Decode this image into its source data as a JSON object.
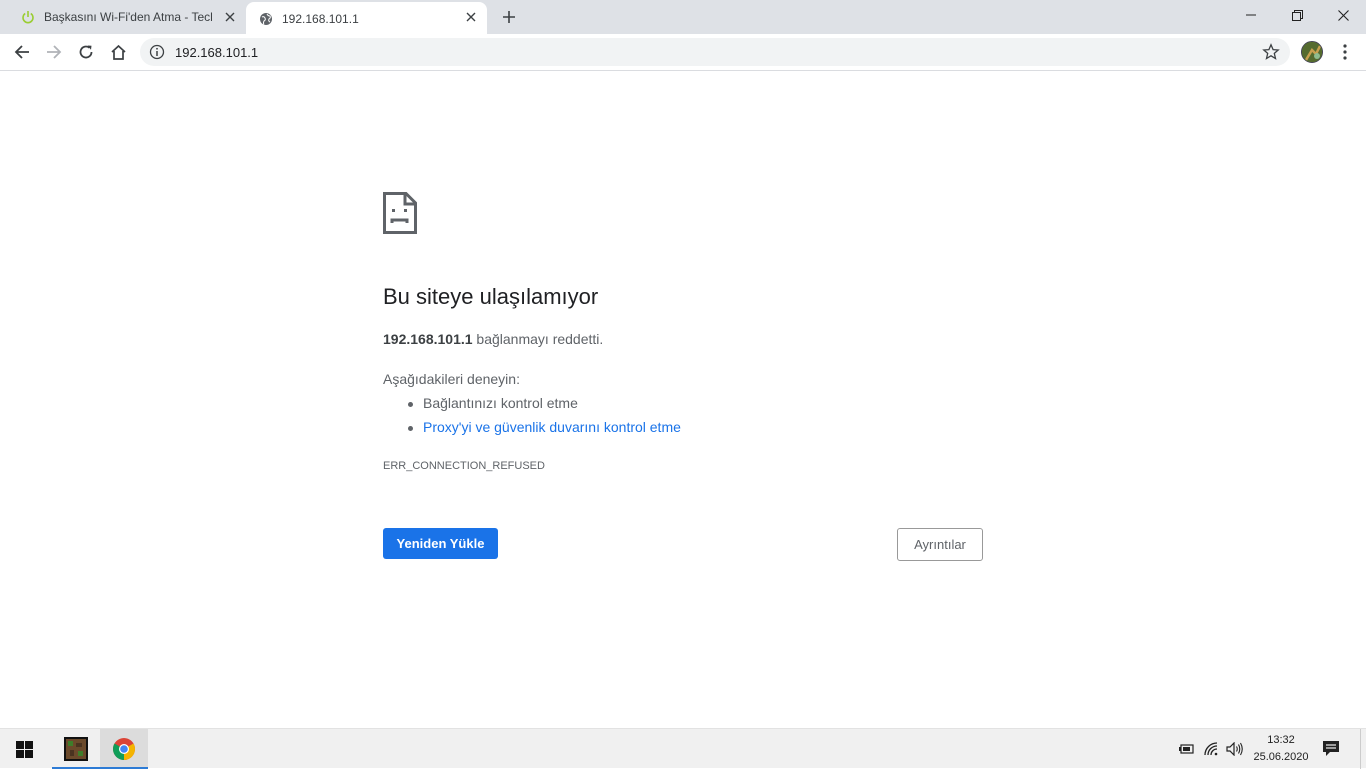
{
  "browser": {
    "tabs": [
      {
        "title": "Başkasını Wi-Fi'den Atma - Techn",
        "active": false,
        "favicon": "power-icon"
      },
      {
        "title": "192.168.101.1",
        "active": true,
        "favicon": "globe-icon"
      }
    ],
    "address": {
      "url": "192.168.101.1",
      "info_icon": "info-icon"
    }
  },
  "error_page": {
    "heading": "Bu siteye ulaşılamıyor",
    "host": "192.168.101.1",
    "desc_suffix": " bağlanmayı reddetti.",
    "try_label": "Aşağıdakileri deneyin:",
    "suggestions": [
      "Bağlantınızı kontrol etme",
      "Proxy'yi ve güvenlik duvarını kontrol etme"
    ],
    "error_code": "ERR_CONNECTION_REFUSED",
    "reload_label": "Yeniden Yükle",
    "details_label": "Ayrıntılar"
  },
  "taskbar": {
    "time": "13:32",
    "date": "25.06.2020"
  },
  "colors": {
    "accent": "#1a73e8",
    "tabstrip": "#dee1e6",
    "taskbar": "#f0f0f0"
  }
}
